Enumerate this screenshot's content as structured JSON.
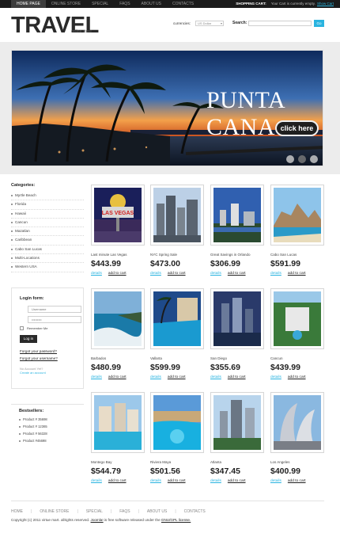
{
  "topbar": {
    "nav": [
      "HOME PAGE",
      "ONLINE STORE",
      "SPECIAL",
      "FAQS",
      "ABOUT US",
      "CONTACTS"
    ],
    "shopping_cart_label": "SHOPPING CART:",
    "cart_text": "Your Cart is currently empty.",
    "show_cart": "Show Cart"
  },
  "header": {
    "logo": "TRAVEL",
    "logo_sub": "online store",
    "currencies_label": "currencies:",
    "currency_value": "US Dollar",
    "search_label": "Search:",
    "go_label": "Go"
  },
  "banner": {
    "title": "PUNTA CANA",
    "button": "click here"
  },
  "categories": {
    "title": "Categories:",
    "items": [
      "Myrtle Beach",
      "Florida",
      "Hawaii",
      "Cancun",
      "Mazatlan",
      "Caribbean",
      "Cabo San Lucas",
      "Multi-Locations",
      "Western USA"
    ]
  },
  "login": {
    "title": "Login form:",
    "username_placeholder": "Username",
    "password_placeholder": "•••••••••",
    "remember": "Remember Me",
    "button": "Log in",
    "forgot_password": "Forgot your password?",
    "forgot_username": "Forgot your username?",
    "no_account": "No Account Yet?",
    "create": "Create an account"
  },
  "bestsellers": {
    "title": "Bestsellers:",
    "items": [
      "Product # 35698",
      "Product # 12365",
      "Product # 56328",
      "Product #45698"
    ]
  },
  "product_links": {
    "details": "details",
    "add": "add to cart"
  },
  "products": [
    {
      "name": "Last minute Las Vegas",
      "price": "$443.99"
    },
    {
      "name": "NYC Spring Sale",
      "price": "$473.00"
    },
    {
      "name": "Great Savings in Orlando",
      "price": "$306.99"
    },
    {
      "name": "Cabo San Lucas",
      "price": "$591.99"
    },
    {
      "name": "Barbados",
      "price": "$480.99"
    },
    {
      "name": "Vallarta",
      "price": "$599.99"
    },
    {
      "name": "San Diego",
      "price": "$355.69"
    },
    {
      "name": "Cancun",
      "price": "$439.99"
    },
    {
      "name": "Montego Bay",
      "price": "$544.79"
    },
    {
      "name": "Riviera Maya",
      "price": "$501.56"
    },
    {
      "name": "Atlanta",
      "price": "$347.45"
    },
    {
      "name": "Los Angeles",
      "price": "$400.99"
    }
  ],
  "footer": {
    "nav": [
      "HOME",
      "ONLINE STORE",
      "SPECIAL",
      "FAQS",
      "ABOUT US",
      "CONTACTS"
    ],
    "copyright_pre": "Copyright (c) 2011 virtue mart. allrights reserved.",
    "joomla": "Joomla!",
    "copyright_mid": "is free software released under the",
    "license": "GNU/GPL license."
  }
}
